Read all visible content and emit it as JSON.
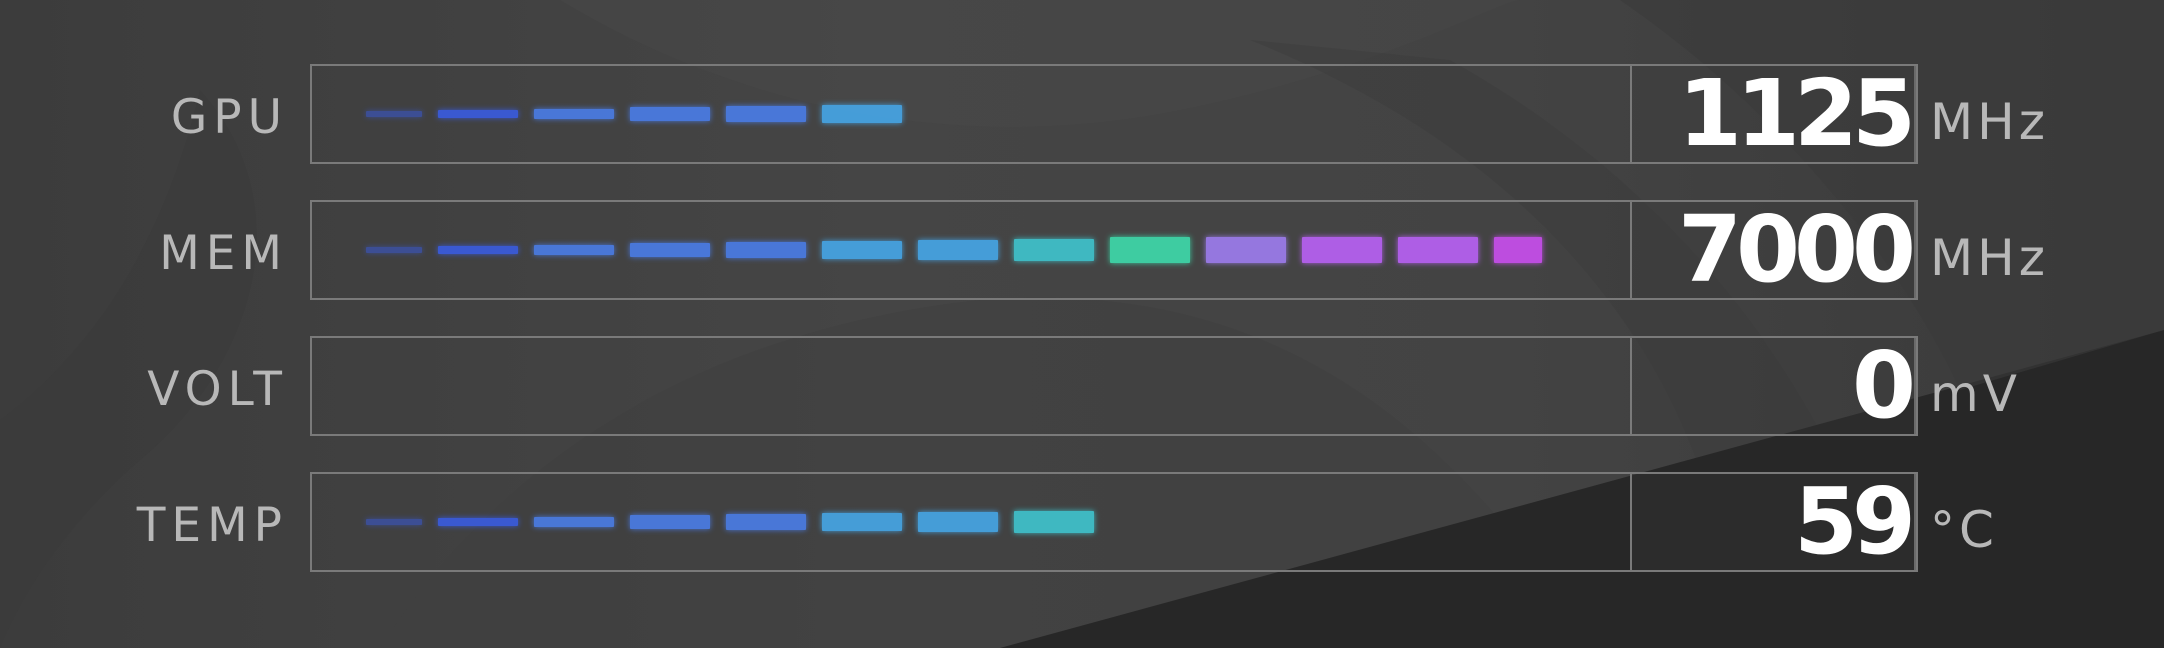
{
  "rows": [
    {
      "label": "GPU",
      "value": "1125",
      "unit": "MHz",
      "segments_lit": 6
    },
    {
      "label": "MEM",
      "value": "7000",
      "unit": "MHz",
      "segments_lit": 13
    },
    {
      "label": "VOLT",
      "value": "0",
      "unit": "mV",
      "segments_lit": 0
    },
    {
      "label": "TEMP",
      "value": "59",
      "unit": "°C",
      "segments_lit": 8
    }
  ],
  "colors": {
    "label": "#b8b8b8",
    "value": "#ffffff",
    "border": "#7a7a7a",
    "segment_gradient": [
      "#3a5bd9",
      "#4a7ae0",
      "#46a2e0",
      "#3fbfc8",
      "#3ed4a6",
      "#9a7ae8",
      "#b460ee",
      "#c44ee8"
    ]
  },
  "icons": [
    "background-swirl-decoration"
  ]
}
